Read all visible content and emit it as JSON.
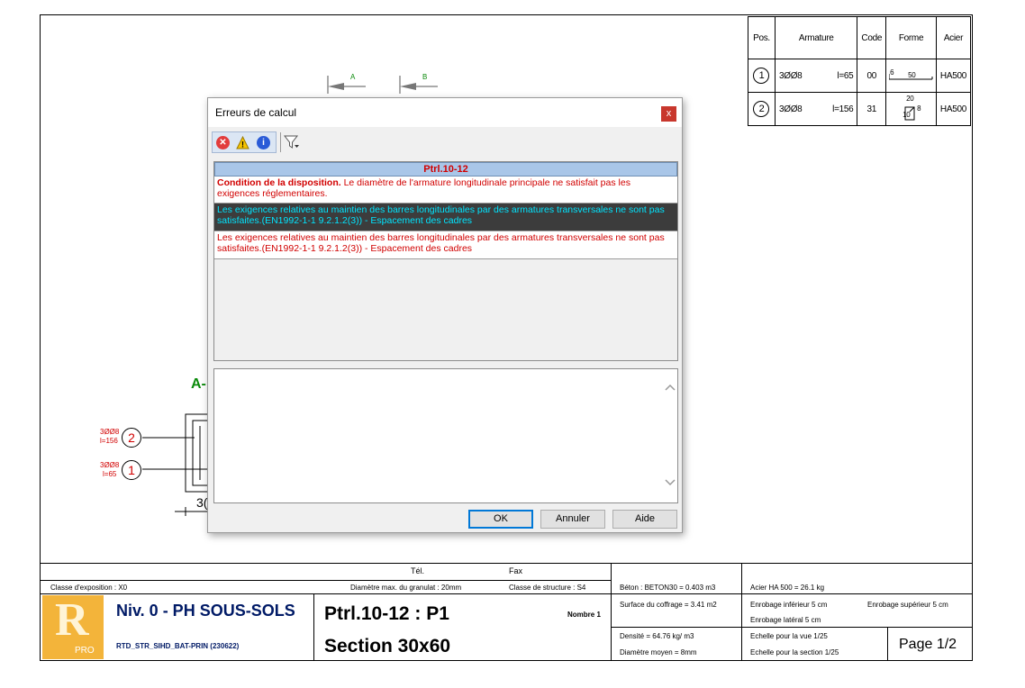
{
  "rebar_table": {
    "headers": [
      "Pos.",
      "Armature",
      "Code",
      "Forme",
      "Acier"
    ],
    "rows": [
      {
        "pos": "1",
        "bars": "3ØØ8",
        "length": "l=65",
        "code": "00",
        "shape_dims": [
          "6",
          "50"
        ],
        "steel": "HA500"
      },
      {
        "pos": "2",
        "bars": "3ØØ8",
        "length": "l=156",
        "code": "31",
        "shape_dims": [
          "20",
          "10",
          "8"
        ],
        "steel": "HA500"
      }
    ]
  },
  "drawing": {
    "cut_a": "A",
    "cut_b": "B",
    "section_label": "A-",
    "callout_2": {
      "num": "2",
      "bars": "3ØØ8",
      "length": "l=156"
    },
    "callout_1": {
      "num": "1",
      "bars": "3ØØ8",
      "length": "l=65"
    },
    "dim_partial": "3("
  },
  "title_block": {
    "tel": "Tél.",
    "fax": "Fax",
    "exposure_class": "Classe d'exposition : X0",
    "aggregate": "Diamètre max. du granulat : 20mm",
    "structure_class": "Classe de structure : S4",
    "level": "Niv. 0 - PH SOUS-SOLS",
    "project_code": "RTD_STR_SIHD_BAT-PRIN (230622)",
    "element": "Ptrl.10-12 : P1",
    "section": "Section 30x60",
    "count_label": "Nombre 1",
    "concrete": "Béton : BETON30 = 0.403 m3",
    "formwork": "Surface du coffrage = 3.41 m2",
    "density": "Densité = 64.76 kg/ m3",
    "avg_diameter": "Diamètre moyen = 8mm",
    "steel": "Acier HA 500 = 26.1 kg",
    "cover_bottom": "Enrobage inférieur 5 cm",
    "cover_top": "Enrobage supérieur 5 cm",
    "cover_side": "Enrobage latéral 5 cm",
    "scale_view": "Echelle pour la vue 1/25",
    "scale_section": "Echelle pour la section 1/25",
    "page": "Page 1/2",
    "logo_letter": "R",
    "logo_sub": "PRO"
  },
  "dialog": {
    "title": "Erreurs de calcul",
    "close": "x",
    "group_header": "Ptrl.10-12",
    "messages": [
      {
        "bold": "Condition de la disposition.",
        "text": " Le diamètre de l'armature longitudinale principale ne satisfait pas les exigences réglementaires."
      },
      {
        "bold": "",
        "text": "Les exigences relatives au maintien des barres longitudinales par des armatures transversales ne sont pas satisfaites.(EN1992-1-1 9.2.1.2(3)) - Espacement des cadres"
      },
      {
        "bold": "",
        "text": "Les exigences relatives au maintien des barres longitudinales par des armatures transversales ne sont pas satisfaites.(EN1992-1-1 9.2.1.2(3)) - Espacement des cadres"
      }
    ],
    "ok": "OK",
    "cancel": "Annuler",
    "help": "Aide",
    "colors": {
      "selected_bg": "#3c3c3c",
      "selected_fg": "#00e5ff",
      "error": "#d10000",
      "header_bg": "#a9c6e8"
    }
  }
}
